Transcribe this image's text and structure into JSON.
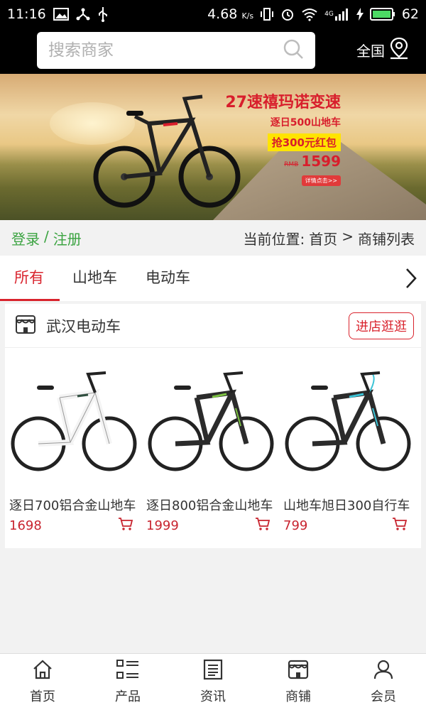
{
  "status_bar": {
    "time": "11:16",
    "speed": "4.68",
    "speed_unit": "K/s",
    "network": "4G",
    "battery": "62"
  },
  "header": {
    "search_placeholder": "搜索商家",
    "region": "全国"
  },
  "banner": {
    "headline": "27速禧玛诺变速",
    "subline": "逐日500山地车",
    "promo": "抢300元红包",
    "old_price": "RMB",
    "price": "1599",
    "cta": "详情点击>>"
  },
  "breadcrumb": {
    "login": "登录",
    "separator": "/",
    "register": "注册",
    "location_label": "当前位置:",
    "home": "首页",
    "arrow": ">",
    "current": "商铺列表"
  },
  "tabs": [
    {
      "label": "所有",
      "active": true
    },
    {
      "label": "山地车",
      "active": false
    },
    {
      "label": "电动车",
      "active": false
    }
  ],
  "shop": {
    "name": "武汉电动车",
    "enter_button": "进店逛逛",
    "products": [
      {
        "name": "逐日700铝合金山地车",
        "price": "1698",
        "frame_color": "#f4f4f4",
        "accent": "#2f4f3f"
      },
      {
        "name": "逐日800铝合金山地车",
        "price": "1999",
        "frame_color": "#2b2b2b",
        "accent": "#7cc142"
      },
      {
        "name": "山地车旭日300自行车",
        "price": "799",
        "frame_color": "#2b2b2b",
        "accent": "#3cc3d6"
      }
    ]
  },
  "bottom_nav": [
    {
      "label": "首页",
      "icon": "home-icon"
    },
    {
      "label": "产品",
      "icon": "list-icon"
    },
    {
      "label": "资讯",
      "icon": "news-icon"
    },
    {
      "label": "商铺",
      "icon": "store-icon"
    },
    {
      "label": "会员",
      "icon": "user-icon"
    }
  ],
  "colors": {
    "accent_red": "#d9232d",
    "login_green": "#3aa340",
    "price_red": "#c8242f"
  }
}
